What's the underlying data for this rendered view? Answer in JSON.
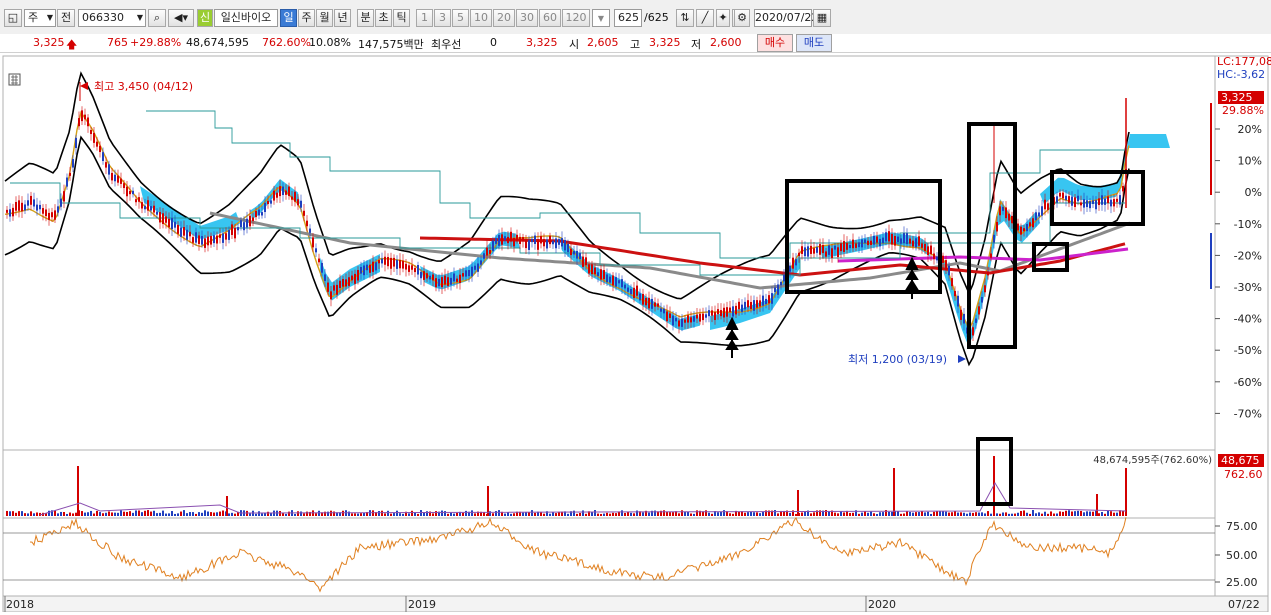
{
  "toolbar": {
    "period_select": "주",
    "prev_label": "전",
    "code": "066330",
    "badge": "신",
    "stock_name": "일신바이오",
    "tabs": [
      "일",
      "주",
      "월",
      "년",
      "분",
      "초",
      "틱"
    ],
    "active_tab": "일",
    "intervals": [
      "1",
      "3",
      "5",
      "10",
      "20",
      "30",
      "60",
      "120"
    ],
    "count": "625",
    "count_total": "/625",
    "date": "2020/07/22"
  },
  "quote": {
    "price": "3,325",
    "change": "765",
    "change_pct": "+29.88%",
    "volume": "48,674,595",
    "volume_ratio": "762.60%",
    "turnover": "10.08%",
    "amount": "147,575백만",
    "best_bid_label": "최우선",
    "best_bid_val": "0",
    "last": "3,325",
    "open_label": "시",
    "open": "2,605",
    "high_label": "고",
    "high": "3,325",
    "low_label": "저",
    "low": "2,600",
    "buy_label": "매수",
    "sell_label": "매도"
  },
  "chart": {
    "lc_label": "LC:177,08",
    "hc_label": "HC:-3,62",
    "price_tag": "3,325",
    "pct_tag": "29.88%",
    "pct_ticks": [
      "20%",
      "10%",
      "0%",
      "-10%",
      "-20%",
      "-30%",
      "-40%",
      "-50%",
      "-60%",
      "-70%"
    ],
    "high_annotation": "최고 3,450 (04/12)",
    "low_annotation": "최저 1,200 (03/19)",
    "volume_label": "48,674,595주(762.60%)",
    "volume_tag": "48,675",
    "volume_pct_tag": "762.60",
    "rsi_ticks": [
      "75.00",
      "50.00",
      "25.00"
    ],
    "x_labels": [
      "2018",
      "2019",
      "2020",
      "07/22"
    ]
  },
  "colors": {
    "up": "#d40000",
    "down": "#1f3fbf",
    "cloud": "#22bff0",
    "ma_red": "#cc1111",
    "ma_purple": "#cc22cc",
    "ma_grey": "#8a8a8a",
    "ma_gold": "#d4a017",
    "bollinger": "#000000",
    "teal": "#2a9a9a",
    "rsi": "#e08020"
  }
}
